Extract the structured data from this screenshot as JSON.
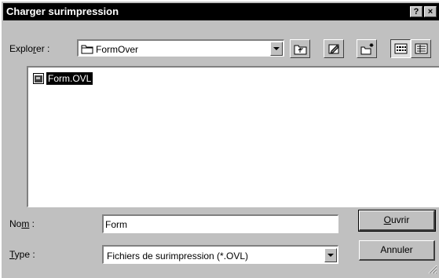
{
  "window": {
    "title": "Charger surimpression",
    "help_button": "?",
    "close_button": "×"
  },
  "lookin": {
    "label_pre": "Explo",
    "label_u": "r",
    "label_post": "er :",
    "value": "FormOver"
  },
  "toolbar": {
    "up_folder": "up-folder-icon",
    "desktop": "desktop-icon",
    "new_folder": "new-folder-icon",
    "list_view": "list-view-icon",
    "details_view": "details-view-icon"
  },
  "files": [
    {
      "name": "Form.OVL",
      "selected": true
    }
  ],
  "filename": {
    "label_pre": "No",
    "label_u": "m",
    "label_post": " :",
    "value": "Form"
  },
  "filetype": {
    "label_pre": "",
    "label_u": "T",
    "label_post": "ype :",
    "value": "Fichiers de surimpression (*.OVL)"
  },
  "buttons": {
    "open_u": "O",
    "open_rest": "uvrir",
    "cancel": "Annuler"
  },
  "colors": {
    "face": "#c0c0c0",
    "titlebar": "#000000",
    "selection": "#000000"
  }
}
